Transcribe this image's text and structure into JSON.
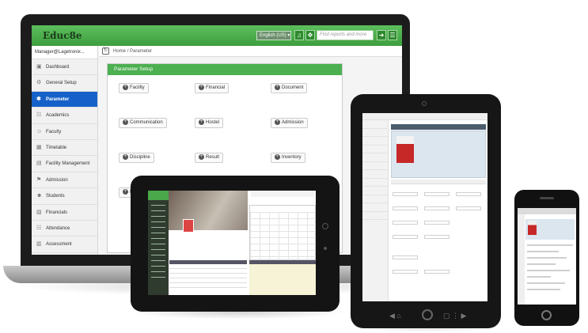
{
  "laptop": {
    "logo": "Educ8e",
    "topbar": {
      "language": "English (US) ▾",
      "search_placeholder": "Find reports and more"
    },
    "user": "Manager@Lagetronix...",
    "breadcrumb": {
      "home": "Home",
      "sep": "/",
      "current": "Parameter"
    },
    "sidebar": [
      {
        "label": "Dashboard",
        "icon": "dashboard-icon",
        "glyph": "▣"
      },
      {
        "label": "General Setup",
        "icon": "gear-icon",
        "glyph": "⚙"
      },
      {
        "label": "Parameter",
        "icon": "cog-icon",
        "glyph": "✱",
        "active": true
      },
      {
        "label": "Academics",
        "icon": "book-icon",
        "glyph": "☷"
      },
      {
        "label": "Faculty",
        "icon": "user-icon",
        "glyph": "☺"
      },
      {
        "label": "Timetable",
        "icon": "table-icon",
        "glyph": "▦"
      },
      {
        "label": "Facility Management",
        "icon": "building-icon",
        "glyph": "▤"
      },
      {
        "label": "Admission",
        "icon": "admission-icon",
        "glyph": "⚑"
      },
      {
        "label": "Students",
        "icon": "students-icon",
        "glyph": "☻"
      },
      {
        "label": "Financials",
        "icon": "money-icon",
        "glyph": "▧"
      },
      {
        "label": "Attendance",
        "icon": "calendar-icon",
        "glyph": "☷"
      },
      {
        "label": "Assessment",
        "icon": "chart-icon",
        "glyph": "▥"
      }
    ],
    "panel": {
      "title": "Parameter Setup",
      "buttons": [
        "Facility",
        "Financial",
        "Document",
        "Communication",
        "Hostel",
        "Admission",
        "Discipline",
        "Result",
        "Inventory",
        "Me"
      ]
    }
  },
  "colors": {
    "brand_green": "#4caf50",
    "active_blue": "#1561c9",
    "device_frame": "#161616"
  }
}
